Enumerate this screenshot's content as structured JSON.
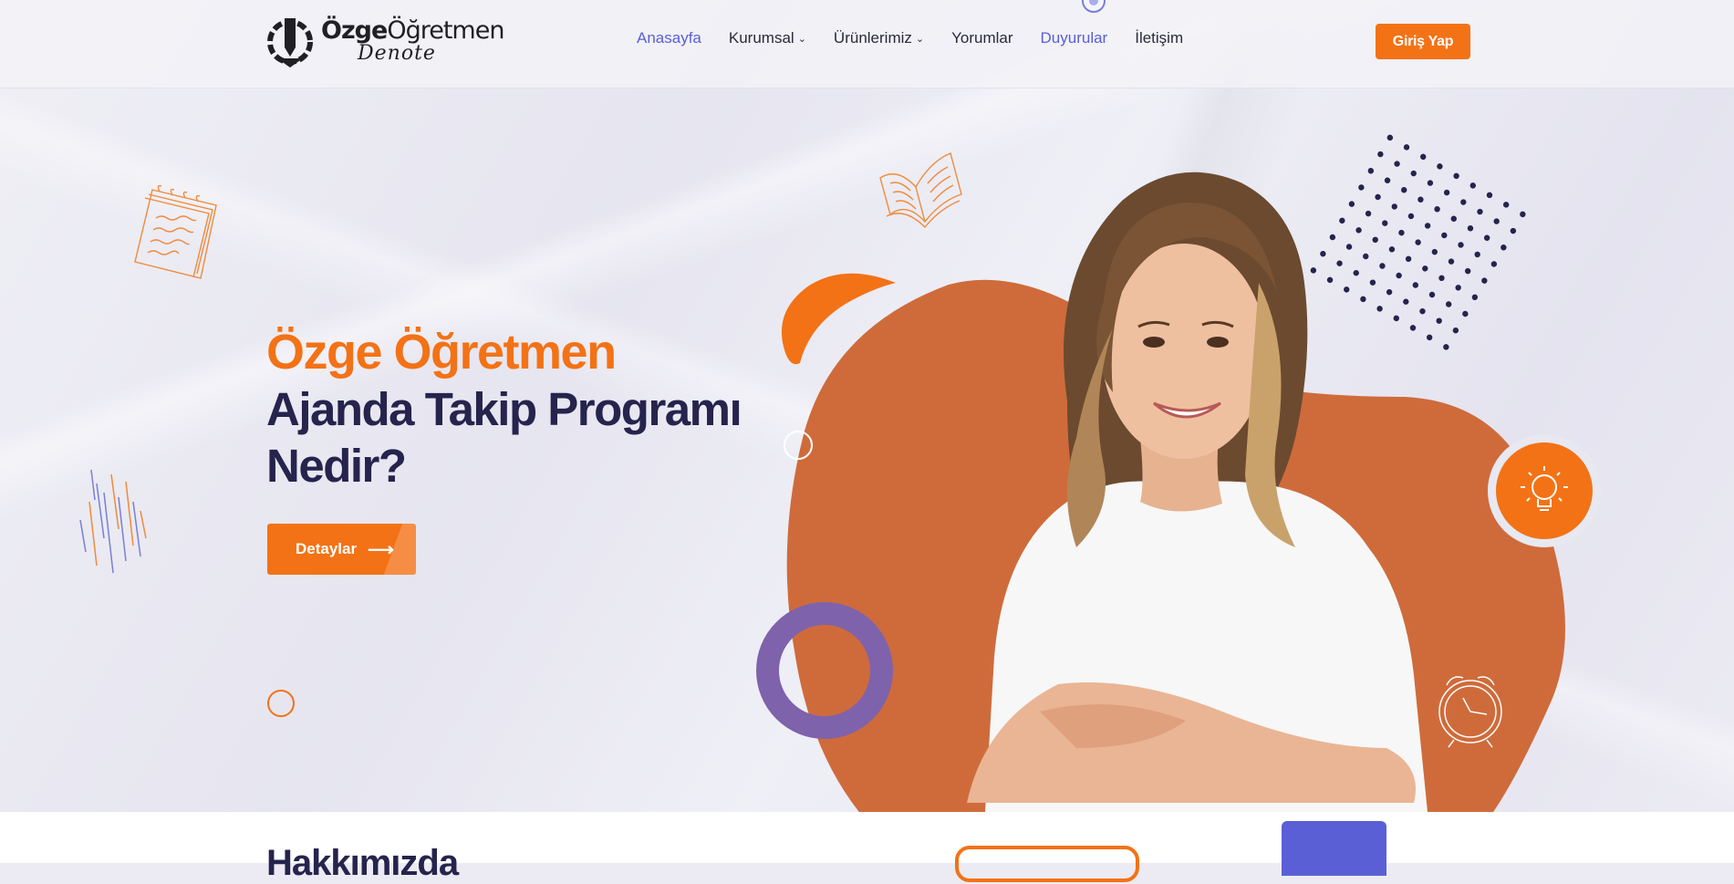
{
  "brand": {
    "name_bold": "Özge",
    "name_rest": "Öğretmen",
    "sub": "Denote"
  },
  "nav": {
    "items": [
      {
        "label": "Anasayfa",
        "active": true,
        "dropdown": false
      },
      {
        "label": "Kurumsal",
        "active": false,
        "dropdown": true
      },
      {
        "label": "Ürünlerimiz",
        "active": false,
        "dropdown": true
      },
      {
        "label": "Yorumlar",
        "active": false,
        "dropdown": false
      },
      {
        "label": "Duyurular",
        "active": true,
        "dropdown": false
      },
      {
        "label": "İletişim",
        "active": false,
        "dropdown": false
      }
    ],
    "login_label": "Giriş Yap"
  },
  "hero": {
    "title_line1": "Özge Öğretmen",
    "title_line2": "Ajanda Takip Programı Nedir?",
    "button_label": "Detaylar",
    "button_icon": "arrow-right-icon"
  },
  "about": {
    "title": "Hakkımızda"
  },
  "colors": {
    "accent": "#f37216",
    "navy": "#26234d",
    "link": "#5a5fd6",
    "blob": "#cf6b3b",
    "purple": "#7e62ac"
  }
}
